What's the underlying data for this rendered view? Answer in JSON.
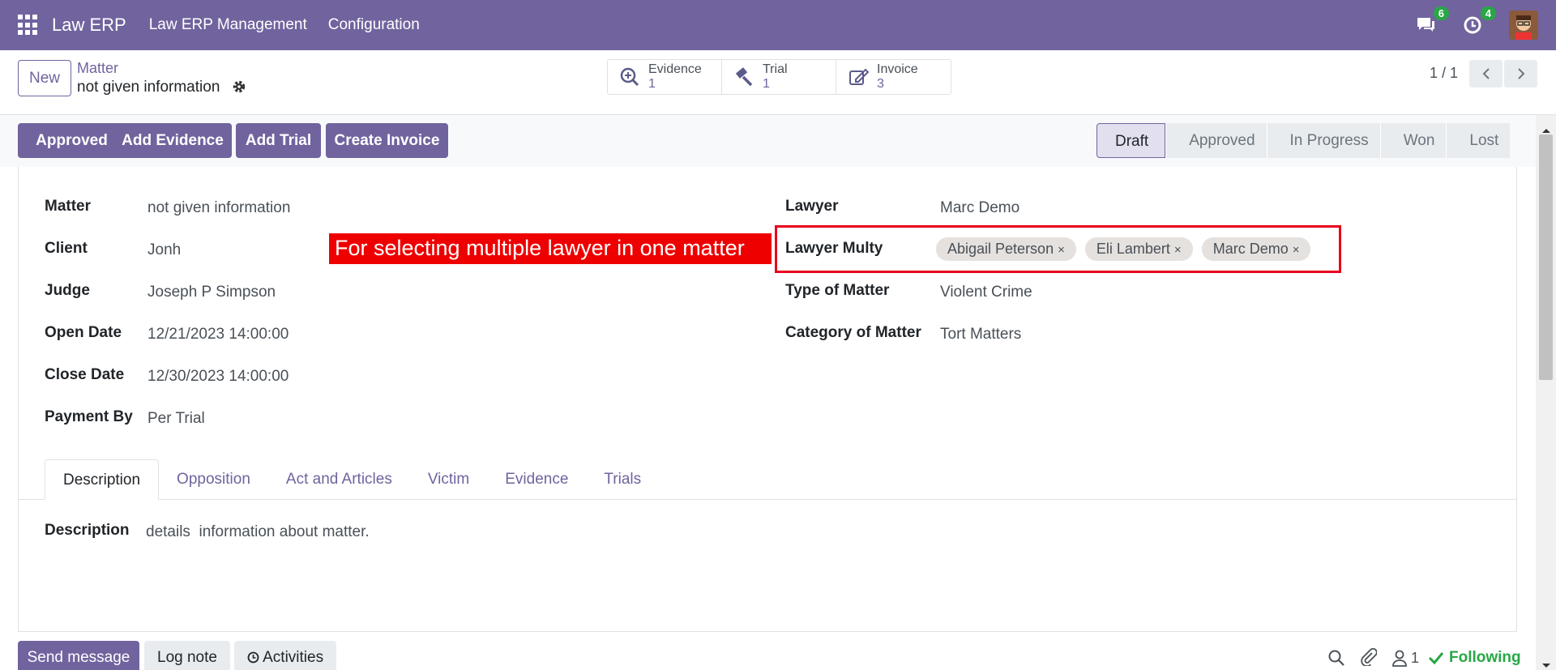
{
  "navbar": {
    "brand": "Law ERP",
    "menus": [
      "Law ERP Management",
      "Configuration"
    ],
    "messages_badge": "6",
    "activities_badge": "4"
  },
  "control_panel": {
    "new_button": "New",
    "breadcrumb_parent": "Matter",
    "breadcrumb_current": "not given information",
    "smart_buttons": [
      {
        "label": "Evidence",
        "value": "1",
        "icon": "search-plus-icon"
      },
      {
        "label": "Trial",
        "value": "1",
        "icon": "gavel-icon"
      },
      {
        "label": "Invoice",
        "value": "3",
        "icon": "edit-icon"
      }
    ],
    "pager": "1 / 1"
  },
  "actions": [
    "Approved",
    "Add Evidence",
    "Add Trial",
    "Create Invoice"
  ],
  "stages": [
    "Draft",
    "Approved",
    "In Progress",
    "Won",
    "Lost"
  ],
  "active_stage": "Draft",
  "form": {
    "left": [
      {
        "label": "Matter",
        "value": "not given information"
      },
      {
        "label": "Client",
        "value": "Jonh"
      },
      {
        "label": "Judge",
        "value": "Joseph P Simpson"
      },
      {
        "label": "Open Date",
        "value": "12/21/2023 14:00:00"
      },
      {
        "label": "Close Date",
        "value": "12/30/2023 14:00:00"
      },
      {
        "label": "Payment By",
        "value": "Per Trial"
      }
    ],
    "lawyer_label": "Lawyer",
    "lawyer_value": "Marc Demo",
    "lawyer_multy_label": "Lawyer Multy",
    "lawyer_multy_tags": [
      "Abigail Peterson",
      "Eli Lambert",
      "Marc Demo"
    ],
    "type_label": "Type of Matter",
    "type_value": "Violent Crime",
    "category_label": "Category of Matter",
    "category_value": "Tort Matters"
  },
  "annotation": "For selecting multiple lawyer in one matter",
  "tabs": [
    "Description",
    "Opposition",
    "Act and Articles",
    "Victim",
    "Evidence",
    "Trials"
  ],
  "description": {
    "label": "Description",
    "value": "details  information about matter."
  },
  "chatter": {
    "send_message": "Send message",
    "log_note": "Log note",
    "activities": "Activities",
    "followers_count": "1",
    "following": "Following"
  },
  "colors": {
    "brand": "#71639e",
    "annotation_red": "#ee0000",
    "following_green": "#28a745"
  }
}
